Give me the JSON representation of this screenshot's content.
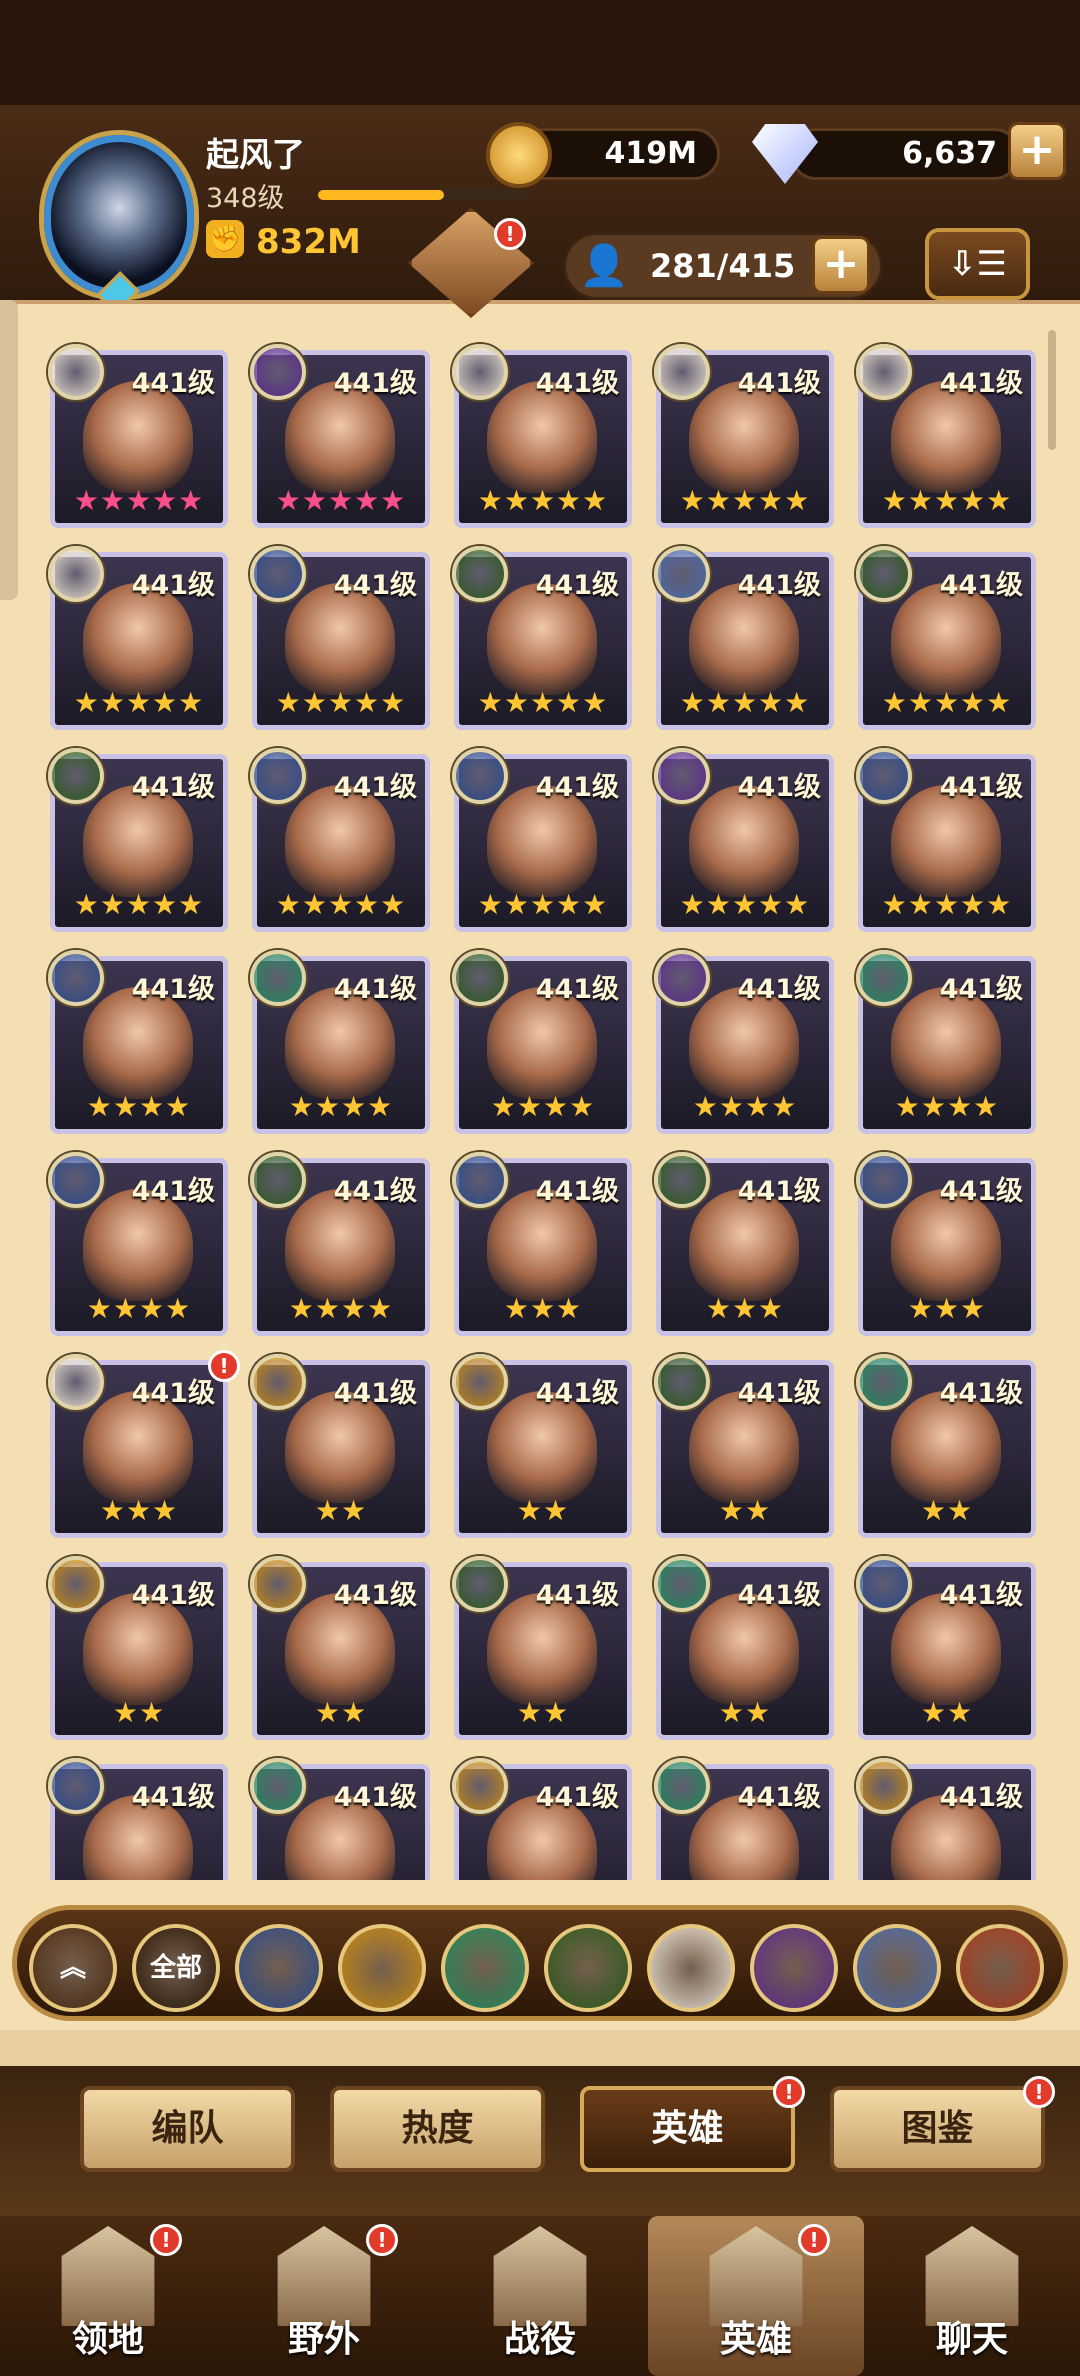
{
  "player": {
    "name": "起风了",
    "level": "348级",
    "xp_fraction": 0.6,
    "power": "832M"
  },
  "resources": {
    "gold": "419M",
    "diamonds": "6,637"
  },
  "heroes_count": "281/415",
  "colors": {
    "panel": "#f4dfb2",
    "accent_gold": "#ffc533",
    "notification": "#e23b2c"
  },
  "hero_level_label": "441级",
  "heroes": [
    {
      "stars": 5,
      "star_color": "pink",
      "faction": "celestial",
      "badge": false
    },
    {
      "stars": 5,
      "star_color": "pink",
      "faction": "hypogean",
      "badge": false
    },
    {
      "stars": 5,
      "star_color": "gold",
      "faction": "celestial",
      "badge": false
    },
    {
      "stars": 5,
      "star_color": "gold",
      "faction": "celestial",
      "badge": false
    },
    {
      "stars": 5,
      "star_color": "gold",
      "faction": "celestial",
      "badge": false
    },
    {
      "stars": 5,
      "star_color": "gold",
      "faction": "celestial",
      "badge": false
    },
    {
      "stars": 5,
      "star_color": "gold",
      "faction": "lightbearer",
      "badge": false
    },
    {
      "stars": 5,
      "star_color": "gold",
      "faction": "graveborn",
      "badge": false
    },
    {
      "stars": 5,
      "star_color": "gold",
      "faction": "dimensional",
      "badge": false
    },
    {
      "stars": 5,
      "star_color": "gold",
      "faction": "graveborn",
      "badge": false
    },
    {
      "stars": 5,
      "star_color": "gold",
      "faction": "graveborn",
      "badge": false
    },
    {
      "stars": 5,
      "star_color": "gold",
      "faction": "lightbearer",
      "badge": false
    },
    {
      "stars": 5,
      "star_color": "gold",
      "faction": "lightbearer",
      "badge": false
    },
    {
      "stars": 5,
      "star_color": "gold",
      "faction": "hypogean",
      "badge": false
    },
    {
      "stars": 5,
      "star_color": "gold",
      "faction": "lightbearer",
      "badge": false
    },
    {
      "stars": 4,
      "star_color": "gold",
      "faction": "lightbearer",
      "badge": false
    },
    {
      "stars": 4,
      "star_color": "gold",
      "faction": "wilder",
      "badge": false
    },
    {
      "stars": 4,
      "star_color": "gold",
      "faction": "graveborn",
      "badge": false
    },
    {
      "stars": 4,
      "star_color": "gold",
      "faction": "hypogean",
      "badge": false
    },
    {
      "stars": 4,
      "star_color": "gold",
      "faction": "wilder",
      "badge": false
    },
    {
      "stars": 4,
      "star_color": "gold",
      "faction": "lightbearer",
      "badge": false
    },
    {
      "stars": 4,
      "star_color": "gold",
      "faction": "graveborn",
      "badge": false
    },
    {
      "stars": 3,
      "star_color": "gold",
      "faction": "lightbearer",
      "badge": false
    },
    {
      "stars": 3,
      "star_color": "gold",
      "faction": "graveborn",
      "badge": false
    },
    {
      "stars": 3,
      "star_color": "gold",
      "faction": "lightbearer",
      "badge": false
    },
    {
      "stars": 3,
      "star_color": "gold",
      "faction": "celestial",
      "badge": true
    },
    {
      "stars": 2,
      "star_color": "gold",
      "faction": "mauler",
      "badge": false
    },
    {
      "stars": 2,
      "star_color": "gold",
      "faction": "mauler",
      "badge": false
    },
    {
      "stars": 2,
      "star_color": "gold",
      "faction": "graveborn",
      "badge": false
    },
    {
      "stars": 2,
      "star_color": "gold",
      "faction": "wilder",
      "badge": false
    },
    {
      "stars": 2,
      "star_color": "gold",
      "faction": "mauler",
      "badge": false
    },
    {
      "stars": 2,
      "star_color": "gold",
      "faction": "mauler",
      "badge": false
    },
    {
      "stars": 2,
      "star_color": "gold",
      "faction": "graveborn",
      "badge": false
    },
    {
      "stars": 2,
      "star_color": "gold",
      "faction": "wilder",
      "badge": false
    },
    {
      "stars": 2,
      "star_color": "gold",
      "faction": "lightbearer",
      "badge": false
    },
    {
      "stars": 0,
      "star_color": "gold",
      "faction": "lightbearer",
      "badge": false
    },
    {
      "stars": 0,
      "star_color": "gold",
      "faction": "wilder",
      "badge": false
    },
    {
      "stars": 0,
      "star_color": "gold",
      "faction": "mauler",
      "badge": false
    },
    {
      "stars": 0,
      "star_color": "gold",
      "faction": "wilder",
      "badge": false
    },
    {
      "stars": 0,
      "star_color": "gold",
      "faction": "mauler",
      "badge": false
    }
  ],
  "filters": [
    {
      "name": "collapse",
      "label": "",
      "icon": "double-chevron-up-icon"
    },
    {
      "name": "all",
      "label": "全部",
      "icon": "all-filter"
    },
    {
      "name": "lightbearer",
      "label": "",
      "icon": "lightbearer-icon",
      "color": "#2a4a8a"
    },
    {
      "name": "mauler",
      "label": "",
      "icon": "mauler-icon",
      "color": "#c88a10"
    },
    {
      "name": "wilder",
      "label": "",
      "icon": "wilder-icon",
      "color": "#1f8a5a"
    },
    {
      "name": "graveborn",
      "label": "",
      "icon": "graveborn-icon",
      "color": "#2a5a1a"
    },
    {
      "name": "celestial",
      "label": "",
      "icon": "celestial-icon",
      "color": "#e8e0d0"
    },
    {
      "name": "hypogean",
      "label": "",
      "icon": "hypogean-icon",
      "color": "#5a2a8a"
    },
    {
      "name": "dimensional",
      "label": "",
      "icon": "dimensional-icon",
      "color": "#4a6aa8"
    },
    {
      "name": "fire",
      "label": "",
      "icon": "fire-icon",
      "color": "#a83a1a"
    }
  ],
  "subtabs": [
    {
      "label": "编队",
      "badge": false,
      "active": false
    },
    {
      "label": "热度",
      "badge": false,
      "active": false
    },
    {
      "label": "英雄",
      "badge": true,
      "active": true
    },
    {
      "label": "图鉴",
      "badge": true,
      "active": false
    }
  ],
  "nav": [
    {
      "label": "领地",
      "badge": true,
      "active": false,
      "icon": "castle-icon"
    },
    {
      "label": "野外",
      "badge": true,
      "active": false,
      "icon": "map-icon"
    },
    {
      "label": "战役",
      "badge": false,
      "active": false,
      "icon": "sword-icon"
    },
    {
      "label": "英雄",
      "badge": true,
      "active": true,
      "icon": "helmet-icon"
    },
    {
      "label": "聊天",
      "badge": false,
      "active": false,
      "icon": "chat-icon"
    }
  ]
}
